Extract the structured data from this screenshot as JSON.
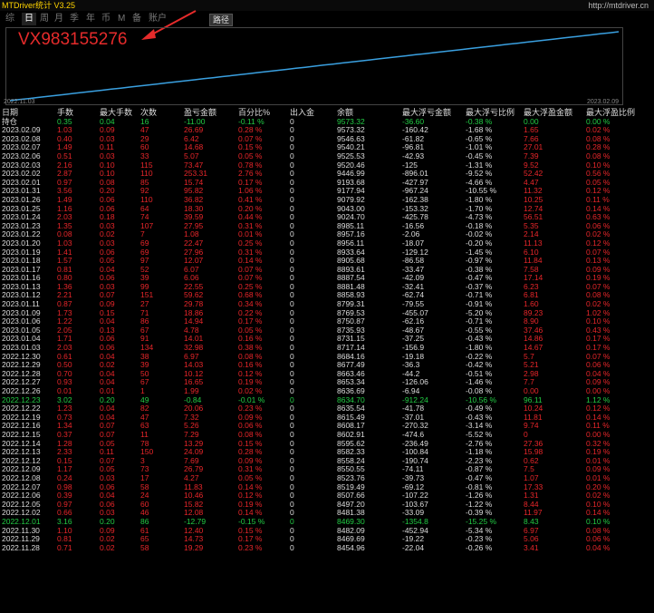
{
  "app": {
    "title": "MTDriver统计 V3.25",
    "site": "http://mtdriver.cn"
  },
  "tabs": [
    {
      "label": "综"
    },
    {
      "label": "日"
    },
    {
      "label": "周"
    },
    {
      "label": "月"
    },
    {
      "label": "季"
    },
    {
      "label": "年"
    },
    {
      "label": "币"
    },
    {
      "label": "M"
    },
    {
      "label": "备"
    },
    {
      "label": "账户"
    }
  ],
  "path_button": "路径",
  "watermark": "VX983155276",
  "chart_data": {
    "type": "line",
    "x_start": "2022.11.03",
    "x_end": "2023.02.09",
    "color": "#3aa0e0",
    "values": [
      0,
      10,
      20,
      30,
      40,
      50,
      60,
      70,
      80,
      90,
      100,
      110,
      120,
      130,
      140,
      150,
      160,
      170,
      180,
      190,
      200,
      210,
      220,
      230,
      240,
      250,
      260,
      270,
      280,
      290,
      300,
      310,
      320,
      330,
      340,
      350,
      360,
      370,
      380,
      390,
      400,
      410,
      420,
      430,
      440,
      450,
      460,
      470,
      480,
      490,
      500,
      510,
      520,
      530,
      540,
      550,
      560,
      570,
      580,
      590,
      600,
      610,
      620,
      630,
      640,
      650,
      660
    ]
  },
  "headers": [
    "日期",
    "手数",
    "最大手数",
    "次数",
    "盈亏金额",
    "百分比%",
    "出入金",
    "余额",
    "最大浮亏金额",
    "最大浮亏比例",
    "最大浮盈金额",
    "最大浮盈比例"
  ],
  "summary": {
    "date": "持仓",
    "lots": "0.35",
    "max_lots": "0.04",
    "count": "16",
    "pnl": "-11.00",
    "pct": "-0.11 %",
    "inout": "0",
    "balance": "9573.32",
    "max_float_loss": "-36.60",
    "max_float_loss_pct": "-0.38 %",
    "max_float_profit": "0.00",
    "max_float_profit_pct": "0.00 %"
  },
  "rows": [
    {
      "date": "2023.02.09",
      "lots": "1.03",
      "max_lots": "0.09",
      "count": "47",
      "pnl": "26.69",
      "pct": "0.28 %",
      "inout": "0",
      "balance": "9573.32",
      "max_float_loss": "-160.42",
      "max_float_loss_pct": "-1.68 %",
      "max_float_profit": "1.65",
      "max_float_profit_pct": "0.02 %"
    },
    {
      "date": "2023.02.08",
      "lots": "0.40",
      "max_lots": "0.03",
      "count": "29",
      "pnl": "6.42",
      "pct": "0.07 %",
      "inout": "0",
      "balance": "9546.63",
      "max_float_loss": "-61.82",
      "max_float_loss_pct": "-0.65 %",
      "max_float_profit": "7.66",
      "max_float_profit_pct": "0.08 %"
    },
    {
      "date": "2023.02.07",
      "lots": "1.49",
      "max_lots": "0.11",
      "count": "60",
      "pnl": "14.68",
      "pct": "0.15 %",
      "inout": "0",
      "balance": "9540.21",
      "max_float_loss": "-96.81",
      "max_float_loss_pct": "-1.01 %",
      "max_float_profit": "27.01",
      "max_float_profit_pct": "0.28 %"
    },
    {
      "date": "2023.02.06",
      "lots": "0.51",
      "max_lots": "0.03",
      "count": "33",
      "pnl": "5.07",
      "pct": "0.05 %",
      "inout": "0",
      "balance": "9525.53",
      "max_float_loss": "-42.93",
      "max_float_loss_pct": "-0.45 %",
      "max_float_profit": "7.39",
      "max_float_profit_pct": "0.08 %"
    },
    {
      "date": "2023.02.03",
      "lots": "2.16",
      "max_lots": "0.10",
      "count": "115",
      "pnl": "73.47",
      "pct": "0.78 %",
      "inout": "0",
      "balance": "9520.46",
      "max_float_loss": "-125",
      "max_float_loss_pct": "-1.31 %",
      "max_float_profit": "9.52",
      "max_float_profit_pct": "0.10 %"
    },
    {
      "date": "2023.02.02",
      "lots": "2.87",
      "max_lots": "0.10",
      "count": "110",
      "pnl": "253.31",
      "pct": "2.76 %",
      "inout": "0",
      "balance": "9446.99",
      "max_float_loss": "-896.01",
      "max_float_loss_pct": "-9.52 %",
      "max_float_profit": "52.42",
      "max_float_profit_pct": "0.56 %"
    },
    {
      "date": "2023.02.01",
      "lots": "0.97",
      "max_lots": "0.08",
      "count": "85",
      "pnl": "15.74",
      "pct": "0.17 %",
      "inout": "0",
      "balance": "9193.68",
      "max_float_loss": "-427.97",
      "max_float_loss_pct": "-4.66 %",
      "max_float_profit": "4.47",
      "max_float_profit_pct": "0.05 %"
    },
    {
      "date": "2023.01.31",
      "lots": "3.56",
      "max_lots": "0.20",
      "count": "92",
      "pnl": "95.82",
      "pct": "1.06 %",
      "inout": "0",
      "balance": "9177.94",
      "max_float_loss": "-967.24",
      "max_float_loss_pct": "-10.55 %",
      "max_float_profit": "11.32",
      "max_float_profit_pct": "0.12 %"
    },
    {
      "date": "2023.01.26",
      "lots": "1.49",
      "max_lots": "0.06",
      "count": "110",
      "pnl": "36.82",
      "pct": "0.41 %",
      "inout": "0",
      "balance": "9079.92",
      "max_float_loss": "-162.38",
      "max_float_loss_pct": "-1.80 %",
      "max_float_profit": "10.25",
      "max_float_profit_pct": "0.11 %"
    },
    {
      "date": "2023.01.25",
      "lots": "1.16",
      "max_lots": "0.06",
      "count": "64",
      "pnl": "18.30",
      "pct": "0.20 %",
      "inout": "0",
      "balance": "9043.00",
      "max_float_loss": "-153.32",
      "max_float_loss_pct": "-1.70 %",
      "max_float_profit": "12.74",
      "max_float_profit_pct": "0.14 %"
    },
    {
      "date": "2023.01.24",
      "lots": "2.03",
      "max_lots": "0.18",
      "count": "74",
      "pnl": "39.59",
      "pct": "0.44 %",
      "inout": "0",
      "balance": "9024.70",
      "max_float_loss": "-425.78",
      "max_float_loss_pct": "-4.73 %",
      "max_float_profit": "56.51",
      "max_float_profit_pct": "0.63 %"
    },
    {
      "date": "2023.01.23",
      "lots": "1.35",
      "max_lots": "0.03",
      "count": "107",
      "pnl": "27.95",
      "pct": "0.31 %",
      "inout": "0",
      "balance": "8985.11",
      "max_float_loss": "-16.56",
      "max_float_loss_pct": "-0.18 %",
      "max_float_profit": "5.35",
      "max_float_profit_pct": "0.06 %"
    },
    {
      "date": "2023.01.22",
      "lots": "0.08",
      "max_lots": "0.02",
      "count": "7",
      "pnl": "1.08",
      "pct": "0.01 %",
      "inout": "0",
      "balance": "8957.16",
      "max_float_loss": "-2.06",
      "max_float_loss_pct": "-0.02 %",
      "max_float_profit": "2.14",
      "max_float_profit_pct": "0.02 %"
    },
    {
      "date": "2023.01.20",
      "lots": "1.03",
      "max_lots": "0.03",
      "count": "69",
      "pnl": "22.47",
      "pct": "0.25 %",
      "inout": "0",
      "balance": "8956.11",
      "max_float_loss": "-18.07",
      "max_float_loss_pct": "-0.20 %",
      "max_float_profit": "11.13",
      "max_float_profit_pct": "0.12 %"
    },
    {
      "date": "2023.01.19",
      "lots": "1.41",
      "max_lots": "0.06",
      "count": "69",
      "pnl": "27.96",
      "pct": "0.31 %",
      "inout": "0",
      "balance": "8933.64",
      "max_float_loss": "-129.12",
      "max_float_loss_pct": "-1.45 %",
      "max_float_profit": "6.10",
      "max_float_profit_pct": "0.07 %"
    },
    {
      "date": "2023.01.18",
      "lots": "1.57",
      "max_lots": "0.05",
      "count": "97",
      "pnl": "12.07",
      "pct": "0.14 %",
      "inout": "0",
      "balance": "8905.68",
      "max_float_loss": "-86.58",
      "max_float_loss_pct": "-0.97 %",
      "max_float_profit": "11.84",
      "max_float_profit_pct": "0.13 %"
    },
    {
      "date": "2023.01.17",
      "lots": "0.81",
      "max_lots": "0.04",
      "count": "52",
      "pnl": "6.07",
      "pct": "0.07 %",
      "inout": "0",
      "balance": "8893.61",
      "max_float_loss": "-33.47",
      "max_float_loss_pct": "-0.38 %",
      "max_float_profit": "7.58",
      "max_float_profit_pct": "0.09 %"
    },
    {
      "date": "2023.01.16",
      "lots": "0.80",
      "max_lots": "0.06",
      "count": "39",
      "pnl": "6.06",
      "pct": "0.07 %",
      "inout": "0",
      "balance": "8887.54",
      "max_float_loss": "-42.09",
      "max_float_loss_pct": "-0.47 %",
      "max_float_profit": "17.14",
      "max_float_profit_pct": "0.19 %"
    },
    {
      "date": "2023.01.13",
      "lots": "1.36",
      "max_lots": "0.03",
      "count": "99",
      "pnl": "22.55",
      "pct": "0.25 %",
      "inout": "0",
      "balance": "8881.48",
      "max_float_loss": "-32.41",
      "max_float_loss_pct": "-0.37 %",
      "max_float_profit": "6.23",
      "max_float_profit_pct": "0.07 %"
    },
    {
      "date": "2023.01.12",
      "lots": "2.21",
      "max_lots": "0.07",
      "count": "151",
      "pnl": "59.62",
      "pct": "0.68 %",
      "inout": "0",
      "balance": "8858.93",
      "max_float_loss": "-62.74",
      "max_float_loss_pct": "-0.71 %",
      "max_float_profit": "6.81",
      "max_float_profit_pct": "0.08 %"
    },
    {
      "date": "2023.01.11",
      "lots": "0.87",
      "max_lots": "0.09",
      "count": "27",
      "pnl": "29.78",
      "pct": "0.34 %",
      "inout": "0",
      "balance": "8799.31",
      "max_float_loss": "-79.55",
      "max_float_loss_pct": "-0.91 %",
      "max_float_profit": "1.60",
      "max_float_profit_pct": "0.02 %"
    },
    {
      "date": "2023.01.09",
      "lots": "1.73",
      "max_lots": "0.15",
      "count": "71",
      "pnl": "18.86",
      "pct": "0.22 %",
      "inout": "0",
      "balance": "8769.53",
      "max_float_loss": "-455.07",
      "max_float_loss_pct": "-5.20 %",
      "max_float_profit": "89.23",
      "max_float_profit_pct": "1.02 %"
    },
    {
      "date": "2023.01.06",
      "lots": "1.22",
      "max_lots": "0.04",
      "count": "86",
      "pnl": "14.94",
      "pct": "0.17 %",
      "inout": "0",
      "balance": "8750.87",
      "max_float_loss": "-62.16",
      "max_float_loss_pct": "-0.71 %",
      "max_float_profit": "8.90",
      "max_float_profit_pct": "0.10 %"
    },
    {
      "date": "2023.01.05",
      "lots": "2.05",
      "max_lots": "0.13",
      "count": "67",
      "pnl": "4.78",
      "pct": "0.05 %",
      "inout": "0",
      "balance": "8735.93",
      "max_float_loss": "-48.67",
      "max_float_loss_pct": "-0.55 %",
      "max_float_profit": "37.46",
      "max_float_profit_pct": "0.43 %"
    },
    {
      "date": "2023.01.04",
      "lots": "1.71",
      "max_lots": "0.06",
      "count": "91",
      "pnl": "14.01",
      "pct": "0.16 %",
      "inout": "0",
      "balance": "8731.15",
      "max_float_loss": "-37.25",
      "max_float_loss_pct": "-0.43 %",
      "max_float_profit": "14.86",
      "max_float_profit_pct": "0.17 %"
    },
    {
      "date": "2023.01.03",
      "lots": "2.03",
      "max_lots": "0.06",
      "count": "134",
      "pnl": "32.98",
      "pct": "0.38 %",
      "inout": "0",
      "balance": "8717.14",
      "max_float_loss": "-156.9",
      "max_float_loss_pct": "-1.80 %",
      "max_float_profit": "14.67",
      "max_float_profit_pct": "0.17 %"
    },
    {
      "date": "2022.12.30",
      "lots": "0.61",
      "max_lots": "0.04",
      "count": "38",
      "pnl": "6.97",
      "pct": "0.08 %",
      "inout": "0",
      "balance": "8684.16",
      "max_float_loss": "-19.18",
      "max_float_loss_pct": "-0.22 %",
      "max_float_profit": "5.7",
      "max_float_profit_pct": "0.07 %"
    },
    {
      "date": "2022.12.29",
      "lots": "0.50",
      "max_lots": "0.02",
      "count": "39",
      "pnl": "14.03",
      "pct": "0.16 %",
      "inout": "0",
      "balance": "8677.49",
      "max_float_loss": "-36.3",
      "max_float_loss_pct": "-0.42 %",
      "max_float_profit": "5.21",
      "max_float_profit_pct": "0.06 %"
    },
    {
      "date": "2022.12.28",
      "lots": "0.70",
      "max_lots": "0.04",
      "count": "50",
      "pnl": "10.12",
      "pct": "0.12 %",
      "inout": "0",
      "balance": "8663.46",
      "max_float_loss": "-44.2",
      "max_float_loss_pct": "-0.51 %",
      "max_float_profit": "2.98",
      "max_float_profit_pct": "0.04 %"
    },
    {
      "date": "2022.12.27",
      "lots": "0.93",
      "max_lots": "0.04",
      "count": "67",
      "pnl": "16.65",
      "pct": "0.19 %",
      "inout": "0",
      "balance": "8653.34",
      "max_float_loss": "-126.06",
      "max_float_loss_pct": "-1.46 %",
      "max_float_profit": "7.7",
      "max_float_profit_pct": "0.09 %"
    },
    {
      "date": "2022.12.26",
      "lots": "0.01",
      "max_lots": "0.01",
      "count": "1",
      "pnl": "1.99",
      "pct": "0.02 %",
      "inout": "0",
      "balance": "8636.69",
      "max_float_loss": "-6.94",
      "max_float_loss_pct": "-0.08 %",
      "max_float_profit": "0.00",
      "max_float_profit_pct": "0.00 %"
    },
    {
      "date": "2022.12.23",
      "lots": "3.02",
      "max_lots": "0.20",
      "count": "49",
      "pnl": "-0.84",
      "pct": "-0.01 %",
      "inout": "0",
      "balance": "8634.70",
      "max_float_loss": "-912.24",
      "max_float_loss_pct": "-10.56 %",
      "max_float_profit": "96.11",
      "max_float_profit_pct": "1.12 %"
    },
    {
      "date": "2022.12.22",
      "lots": "1.23",
      "max_lots": "0.04",
      "count": "82",
      "pnl": "20.06",
      "pct": "0.23 %",
      "inout": "0",
      "balance": "8635.54",
      "max_float_loss": "-41.78",
      "max_float_loss_pct": "-0.49 %",
      "max_float_profit": "10.24",
      "max_float_profit_pct": "0.12 %"
    },
    {
      "date": "2022.12.19",
      "lots": "0.73",
      "max_lots": "0.04",
      "count": "47",
      "pnl": "7.32",
      "pct": "0.09 %",
      "inout": "0",
      "balance": "8615.49",
      "max_float_loss": "-37.01",
      "max_float_loss_pct": "-0.43 %",
      "max_float_profit": "11.81",
      "max_float_profit_pct": "0.14 %"
    },
    {
      "date": "2022.12.16",
      "lots": "1.34",
      "max_lots": "0.07",
      "count": "63",
      "pnl": "5.26",
      "pct": "0.06 %",
      "inout": "0",
      "balance": "8608.17",
      "max_float_loss": "-270.32",
      "max_float_loss_pct": "-3.14 %",
      "max_float_profit": "9.74",
      "max_float_profit_pct": "0.11 %"
    },
    {
      "date": "2022.12.15",
      "lots": "0.37",
      "max_lots": "0.07",
      "count": "11",
      "pnl": "7.29",
      "pct": "0.08 %",
      "inout": "0",
      "balance": "8602.91",
      "max_float_loss": "-474.6",
      "max_float_loss_pct": "-5.52 %",
      "max_float_profit": "0",
      "max_float_profit_pct": "0.00 %"
    },
    {
      "date": "2022.12.14",
      "lots": "1.28",
      "max_lots": "0.05",
      "count": "78",
      "pnl": "13.29",
      "pct": "0.15 %",
      "inout": "0",
      "balance": "8595.62",
      "max_float_loss": "-236.49",
      "max_float_loss_pct": "-2.76 %",
      "max_float_profit": "27.36",
      "max_float_profit_pct": "0.32 %"
    },
    {
      "date": "2022.12.13",
      "lots": "2.33",
      "max_lots": "0.11",
      "count": "150",
      "pnl": "24.09",
      "pct": "0.28 %",
      "inout": "0",
      "balance": "8582.33",
      "max_float_loss": "-100.84",
      "max_float_loss_pct": "-1.18 %",
      "max_float_profit": "15.98",
      "max_float_profit_pct": "0.19 %"
    },
    {
      "date": "2022.12.12",
      "lots": "0.15",
      "max_lots": "0.07",
      "count": "3",
      "pnl": "7.69",
      "pct": "0.09 %",
      "inout": "0",
      "balance": "8558.24",
      "max_float_loss": "-190.74",
      "max_float_loss_pct": "-2.23 %",
      "max_float_profit": "0.62",
      "max_float_profit_pct": "0.01 %"
    },
    {
      "date": "2022.12.09",
      "lots": "1.17",
      "max_lots": "0.05",
      "count": "73",
      "pnl": "26.79",
      "pct": "0.31 %",
      "inout": "0",
      "balance": "8550.55",
      "max_float_loss": "-74.11",
      "max_float_loss_pct": "-0.87 %",
      "max_float_profit": "7.5",
      "max_float_profit_pct": "0.09 %"
    },
    {
      "date": "2022.12.08",
      "lots": "0.24",
      "max_lots": "0.03",
      "count": "17",
      "pnl": "4.27",
      "pct": "0.05 %",
      "inout": "0",
      "balance": "8523.76",
      "max_float_loss": "-39.73",
      "max_float_loss_pct": "-0.47 %",
      "max_float_profit": "1.07",
      "max_float_profit_pct": "0.01 %"
    },
    {
      "date": "2022.12.07",
      "lots": "0.98",
      "max_lots": "0.06",
      "count": "58",
      "pnl": "11.83",
      "pct": "0.14 %",
      "inout": "0",
      "balance": "8519.49",
      "max_float_loss": "-69.12",
      "max_float_loss_pct": "-0.81 %",
      "max_float_profit": "17.33",
      "max_float_profit_pct": "0.20 %"
    },
    {
      "date": "2022.12.06",
      "lots": "0.39",
      "max_lots": "0.04",
      "count": "24",
      "pnl": "10.46",
      "pct": "0.12 %",
      "inout": "0",
      "balance": "8507.66",
      "max_float_loss": "-107.22",
      "max_float_loss_pct": "-1.26 %",
      "max_float_profit": "1.31",
      "max_float_profit_pct": "0.02 %"
    },
    {
      "date": "2022.12.05",
      "lots": "0.97",
      "max_lots": "0.06",
      "count": "60",
      "pnl": "15.82",
      "pct": "0.19 %",
      "inout": "0",
      "balance": "8497.20",
      "max_float_loss": "-103.67",
      "max_float_loss_pct": "-1.22 %",
      "max_float_profit": "8.44",
      "max_float_profit_pct": "0.10 %"
    },
    {
      "date": "2022.12.02",
      "lots": "0.66",
      "max_lots": "0.03",
      "count": "46",
      "pnl": "12.08",
      "pct": "0.14 %",
      "inout": "0",
      "balance": "8481.38",
      "max_float_loss": "-33.09",
      "max_float_loss_pct": "-0.39 %",
      "max_float_profit": "11.97",
      "max_float_profit_pct": "0.14 %"
    },
    {
      "date": "2022.12.01",
      "lots": "3.16",
      "max_lots": "0.20",
      "count": "86",
      "pnl": "-12.79",
      "pct": "-0.15 %",
      "inout": "0",
      "balance": "8469.30",
      "max_float_loss": "-1354.8",
      "max_float_loss_pct": "-15.25 %",
      "max_float_profit": "8.43",
      "max_float_profit_pct": "0.10 %"
    },
    {
      "date": "2022.11.30",
      "lots": "1.10",
      "max_lots": "0.09",
      "count": "61",
      "pnl": "12.40",
      "pct": "0.15 %",
      "inout": "0",
      "balance": "8482.09",
      "max_float_loss": "-452.94",
      "max_float_loss_pct": "-5.34 %",
      "max_float_profit": "6.97",
      "max_float_profit_pct": "0.08 %"
    },
    {
      "date": "2022.11.29",
      "lots": "0.81",
      "max_lots": "0.02",
      "count": "65",
      "pnl": "14.73",
      "pct": "0.17 %",
      "inout": "0",
      "balance": "8469.69",
      "max_float_loss": "-19.22",
      "max_float_loss_pct": "-0.23 %",
      "max_float_profit": "5.06",
      "max_float_profit_pct": "0.06 %"
    },
    {
      "date": "2022.11.28",
      "lots": "0.71",
      "max_lots": "0.02",
      "count": "58",
      "pnl": "19.29",
      "pct": "0.23 %",
      "inout": "0",
      "balance": "8454.96",
      "max_float_loss": "-22.04",
      "max_float_loss_pct": "-0.26 %",
      "max_float_profit": "3.41",
      "max_float_profit_pct": "0.04 %"
    }
  ]
}
